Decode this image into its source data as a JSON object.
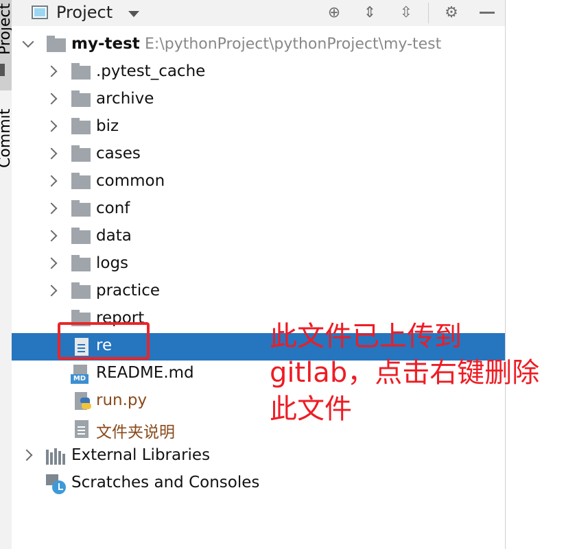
{
  "toolstrip": {
    "project_label": "Project",
    "commit_label": "Commit"
  },
  "header": {
    "title": "Project"
  },
  "tree": {
    "root": {
      "name": "my-test",
      "path": "E:\\pythonProject\\pythonProject\\my-test"
    },
    "folders": [
      ".pytest_cache",
      "archive",
      "biz",
      "cases",
      "common",
      "conf",
      "data",
      "logs",
      "practice",
      "report"
    ],
    "files": {
      "re": "re",
      "readme": "README.md",
      "md_tag": "MD",
      "run": "run.py",
      "notes": "文件夹说明"
    },
    "external_libraries": "External Libraries",
    "scratches": "Scratches and Consoles"
  },
  "annotation": {
    "text": "此文件已上传到gitlab，点击右键删除此文件",
    "color": "#ee1c24"
  },
  "colors": {
    "selection": "#2675bf",
    "folder": "#9fa5aa",
    "accent_red": "#e8262a"
  }
}
